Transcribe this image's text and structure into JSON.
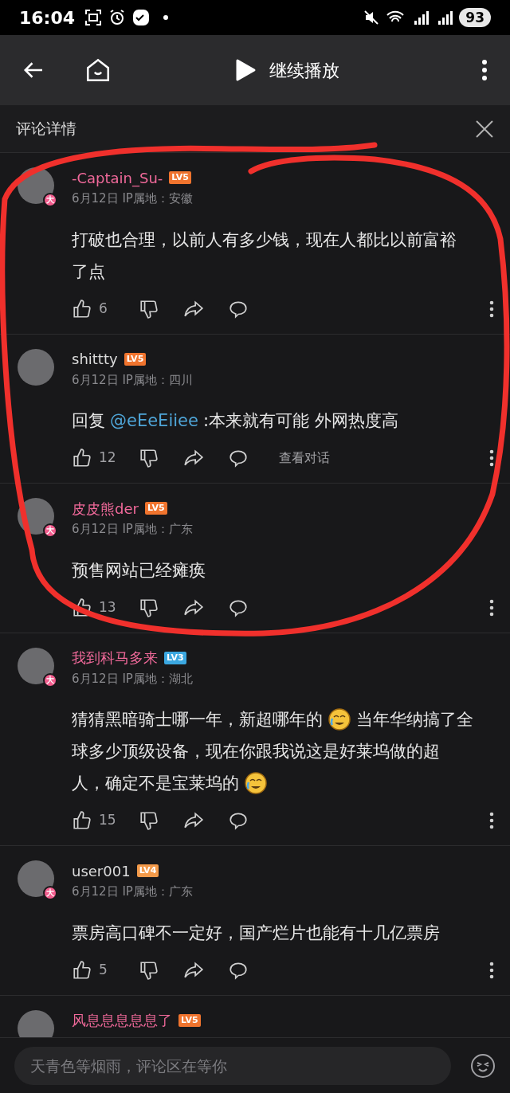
{
  "status_bar": {
    "time": "16:04",
    "battery": "93"
  },
  "header": {
    "title": "继续播放"
  },
  "panel": {
    "title": "评论详情"
  },
  "comments": [
    {
      "name": "-Captain_Su-",
      "vip": true,
      "level": "LV5",
      "color": "#f0742e",
      "badge": "大",
      "date": "6月12日 IP属地：安徽",
      "lines": [
        [
          {
            "kind": "text",
            "text": "打破也合理，以前人有多少钱，现在人都比以前富裕"
          }
        ],
        [
          {
            "kind": "text",
            "text": "了点"
          }
        ]
      ],
      "likes": "6"
    },
    {
      "name": "shittty",
      "vip": false,
      "level": "LV5",
      "color": "#f0742e",
      "date": "6月12日 IP属地：四川",
      "lines": [
        [
          {
            "kind": "text",
            "text": "回复"
          },
          {
            "kind": "mention",
            "text": "@eEeEiiee"
          },
          {
            "kind": "text",
            "text": ":本来就有可能 外网热度高"
          }
        ]
      ],
      "likes": "12",
      "link": "查看对话"
    },
    {
      "name": "皮皮熊der",
      "vip": true,
      "level": "LV5",
      "color": "#f0742e",
      "badge": "大",
      "date": "6月12日 IP属地：广东",
      "lines": [
        [
          {
            "kind": "text",
            "text": "预售网站已经瘫痪"
          }
        ]
      ],
      "likes": "13"
    },
    {
      "name": "我到科马多来",
      "vip": true,
      "level": "LV3",
      "color": "#3ba7e0",
      "badge": "大",
      "date": "6月12日 IP属地：湖北",
      "lines": [
        [
          {
            "kind": "text",
            "text": "猜猜黑暗骑士哪一年，新超哪年的"
          },
          {
            "kind": "emoji"
          },
          {
            "kind": "text",
            "text": "当年华纳搞了全"
          }
        ],
        [
          {
            "kind": "text",
            "text": "球多少顶级设备，现在你跟我说这是好莱坞做的超"
          }
        ],
        [
          {
            "kind": "text",
            "text": "人，确定不是宝莱坞的"
          },
          {
            "kind": "emoji"
          }
        ]
      ],
      "likes": "15"
    },
    {
      "name": "user001",
      "vip": false,
      "level": "LV4",
      "color": "#f39a4a",
      "badge": "大",
      "date": "6月12日 IP属地：广东",
      "lines": [
        [
          {
            "kind": "text",
            "text": "票房高口碑不一定好，国产烂片也能有十几亿票房"
          }
        ]
      ],
      "likes": "5"
    },
    {
      "name": "风息息息息息了",
      "vip": true,
      "level": "LV5",
      "color": "#f0742e"
    }
  ],
  "composer": {
    "placeholder": "天青色等烟雨，评论区在等你"
  }
}
